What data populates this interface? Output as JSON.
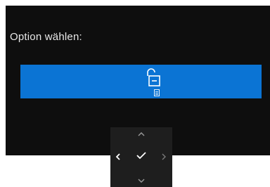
{
  "osd": {
    "title": "Option wählen:",
    "selected_option": {
      "icon": "unlock-icon",
      "sub_icon": "menu-icon"
    }
  },
  "nav_pad": {
    "buttons": [
      "chevron-up-icon",
      "chevron-left-icon",
      "check-icon",
      "chevron-right-icon",
      "chevron-down-icon"
    ]
  },
  "colors": {
    "panel_bg": "#0e0e0e",
    "accent": "#0b74d4",
    "nav_bg": "#1e1e1e"
  }
}
